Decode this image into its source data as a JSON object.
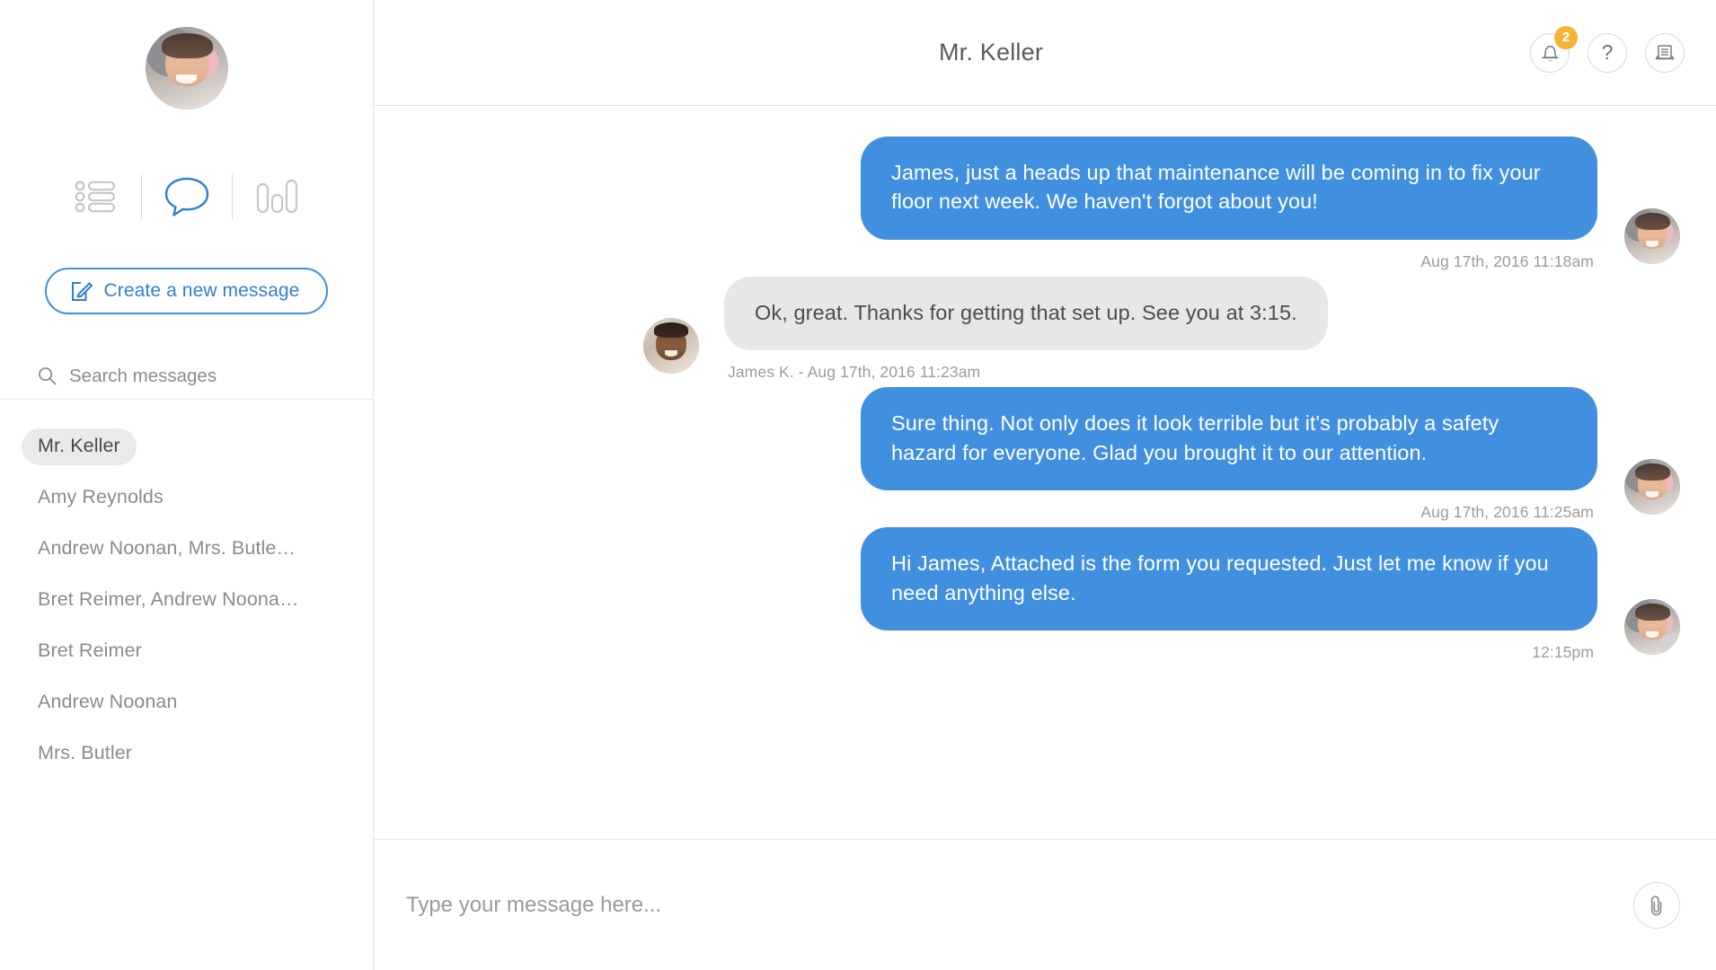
{
  "sidebar": {
    "profile_avatar_alt": "user-profile-photo",
    "nav": [
      {
        "id": "list",
        "icon": "list-icon",
        "active": false
      },
      {
        "id": "messages",
        "icon": "speech-bubble-icon",
        "active": true
      },
      {
        "id": "reports",
        "icon": "bar-chart-icon",
        "active": false
      }
    ],
    "compose_label": "Create a new message",
    "compose_icon": "compose-pencil-icon",
    "search_icon": "search-icon",
    "search_placeholder": "Search messages",
    "search_value": "",
    "conversations": [
      {
        "name": "Mr. Keller",
        "active": true
      },
      {
        "name": "Amy Reynolds",
        "active": false
      },
      {
        "name": "Andrew Noonan, Mrs. Butle…",
        "active": false
      },
      {
        "name": "Bret Reimer, Andrew Noona…",
        "active": false
      },
      {
        "name": "Bret Reimer",
        "active": false
      },
      {
        "name": "Andrew Noonan",
        "active": false
      },
      {
        "name": "Mrs. Butler",
        "active": false
      }
    ]
  },
  "header": {
    "title": "Mr. Keller",
    "actions": [
      {
        "id": "notifications",
        "icon": "bell-icon",
        "badge": "2"
      },
      {
        "id": "help",
        "icon": "question-mark-icon",
        "label": "?"
      },
      {
        "id": "archive",
        "icon": "document-list-icon"
      }
    ]
  },
  "thread": {
    "messages": [
      {
        "direction": "out",
        "text": "James, just a heads up that maintenance will be coming in to fix your floor next week. We haven't forgot about you!",
        "meta": "Aug 17th, 2016 11:18am",
        "avatar": "agent-avatar",
        "status_dot": false
      },
      {
        "direction": "in",
        "text": "Ok, great. Thanks for getting that set up. See you at 3:15.",
        "meta": "James K. - Aug 17th, 2016 11:23am",
        "avatar": "james-avatar",
        "status_dot": false
      },
      {
        "direction": "out",
        "text": "Sure thing. Not only does it look terrible but it's probably a safety hazard for everyone. Glad you brought it to our attention.",
        "meta": "Aug 17th, 2016 11:25am",
        "avatar": "agent-avatar",
        "status_dot": false
      },
      {
        "direction": "out",
        "text": "Hi James, Attached is the form you requested. Just let me know if you need anything else.",
        "meta": "12:15pm",
        "avatar": "agent-avatar",
        "status_dot": true
      }
    ]
  },
  "composer": {
    "placeholder": "Type your message here...",
    "value": "",
    "attach_icon": "paperclip-icon"
  },
  "colors": {
    "accent_blue": "#4190e0",
    "badge_orange": "#f5b335",
    "incoming_bubble": "#e7e7e7",
    "border": "#e6e6e6"
  }
}
